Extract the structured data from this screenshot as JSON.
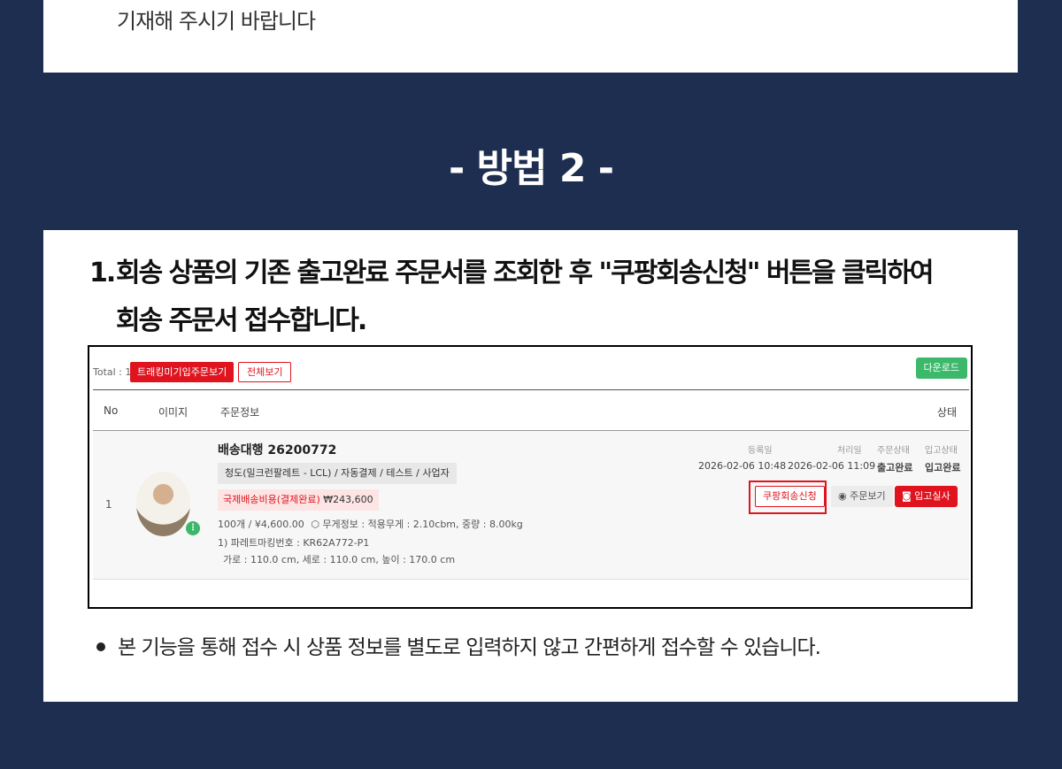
{
  "top_text": "기재해 주시기 바랍니다",
  "method_title": "- 방법 2 -",
  "step": {
    "number": "1.",
    "line1": "회송 상품의 기존 출고완료 주문서를 조회한 후 \"쿠팡회송신청\" 버튼을 클릭하여",
    "line2": "회송 주문서 접수합니다."
  },
  "screenshot": {
    "total_label": "Total : 1",
    "untracked_button": "트래킹미기입주문보기",
    "view_all_button": "전체보기",
    "download_button": "다운로드",
    "headers": {
      "no": "No",
      "image": "이미지",
      "order_info": "주문정보",
      "status": "상태"
    },
    "row": {
      "no": "1",
      "title": "배송대행 26200772",
      "tag": "청도(밀크런팔레트 - LCL) / 자동결제 / 테스트 / 사업자",
      "shipping_label": "국제배송비용(결제완료)",
      "shipping_amount": "₩243,600",
      "qty_price": "100개 / ¥4,600.00",
      "weight": "무게정보 : 적용무게 : 2.10cbm, 중량 : 8.00kg",
      "pallet": "1) 파레트마킹번호 : KR62A772-P1",
      "dims": "가로 : 110.0 cm, 세로 : 110.0 cm, 높이 : 170.0 cm",
      "reg_label": "등록일",
      "reg_date": "2026-02-06 10:48",
      "proc_label": "처리일",
      "proc_date": "2026-02-06 11:09",
      "order_status_label": "주문상태",
      "order_status": "출고완료",
      "in_status_label": "입고상태",
      "in_status": "입고완료",
      "coupang_button": "쿠팡회송신청",
      "view_order_button": "주문보기",
      "inbound_photo_button": "입고실사"
    }
  },
  "note": "본 기능을 통해 접수 시 상품 정보를 별도로 입력하지 않고 간편하게 접수할 수 있습니다.",
  "colors": {
    "background": "#1e2e50",
    "accent_red": "#e0141e",
    "accent_green": "#3cb86a"
  }
}
